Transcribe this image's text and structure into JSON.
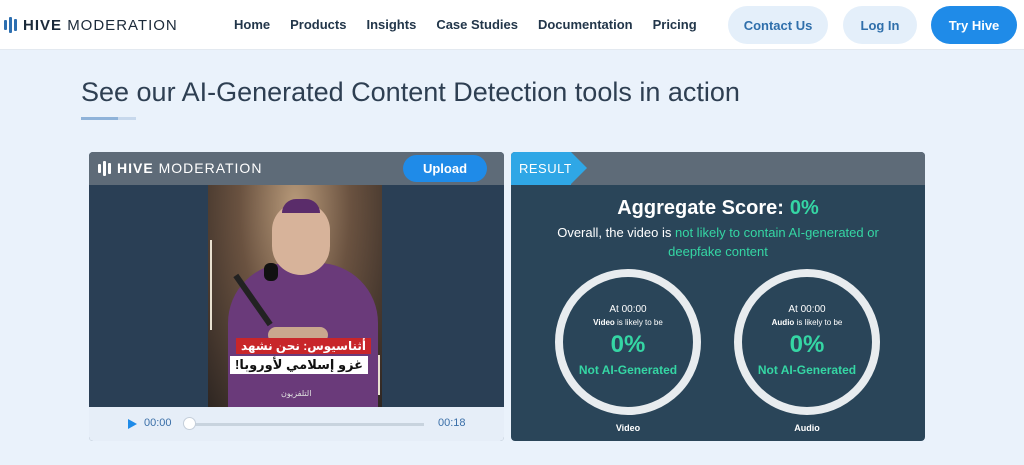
{
  "nav": {
    "logo_bold": "HIVE",
    "logo_light": "MODERATION",
    "links": [
      "Home",
      "Products",
      "Insights",
      "Case Studies",
      "Documentation",
      "Pricing"
    ],
    "contact": "Contact Us",
    "login": "Log In",
    "try": "Try Hive"
  },
  "heading": "See our AI-Generated Content Detection tools in action",
  "demo": {
    "logo_bold": "HIVE",
    "logo_light": "MODERATION",
    "upload": "Upload",
    "caption_line1": "أثناسيوس: نحن نشهد",
    "caption_line2": "غزو إسلامي لأوروبا!",
    "watermark": "التلفزيون",
    "player": {
      "current_time": "00:00",
      "duration": "00:18",
      "progress": 0
    }
  },
  "result": {
    "tab": "RESULT",
    "aggregate_label": "Aggregate Score:",
    "aggregate_value": "0%",
    "overall_prefix": "Overall, the video is",
    "overall_highlight": "not likely to contain AI-generated or deepfake content",
    "gauges": [
      {
        "at": "At 00:00",
        "subject": "Video",
        "likely_text": "is likely to be",
        "percent": "0%",
        "verdict": "Not AI-Generated",
        "label": "Video"
      },
      {
        "at": "At 00:00",
        "subject": "Audio",
        "likely_text": "is likely to be",
        "percent": "0%",
        "verdict": "Not AI-Generated",
        "label": "Audio"
      }
    ]
  },
  "colors": {
    "accent": "#1f8be8",
    "score": "#35d6a4",
    "panel": "#2a4559"
  }
}
